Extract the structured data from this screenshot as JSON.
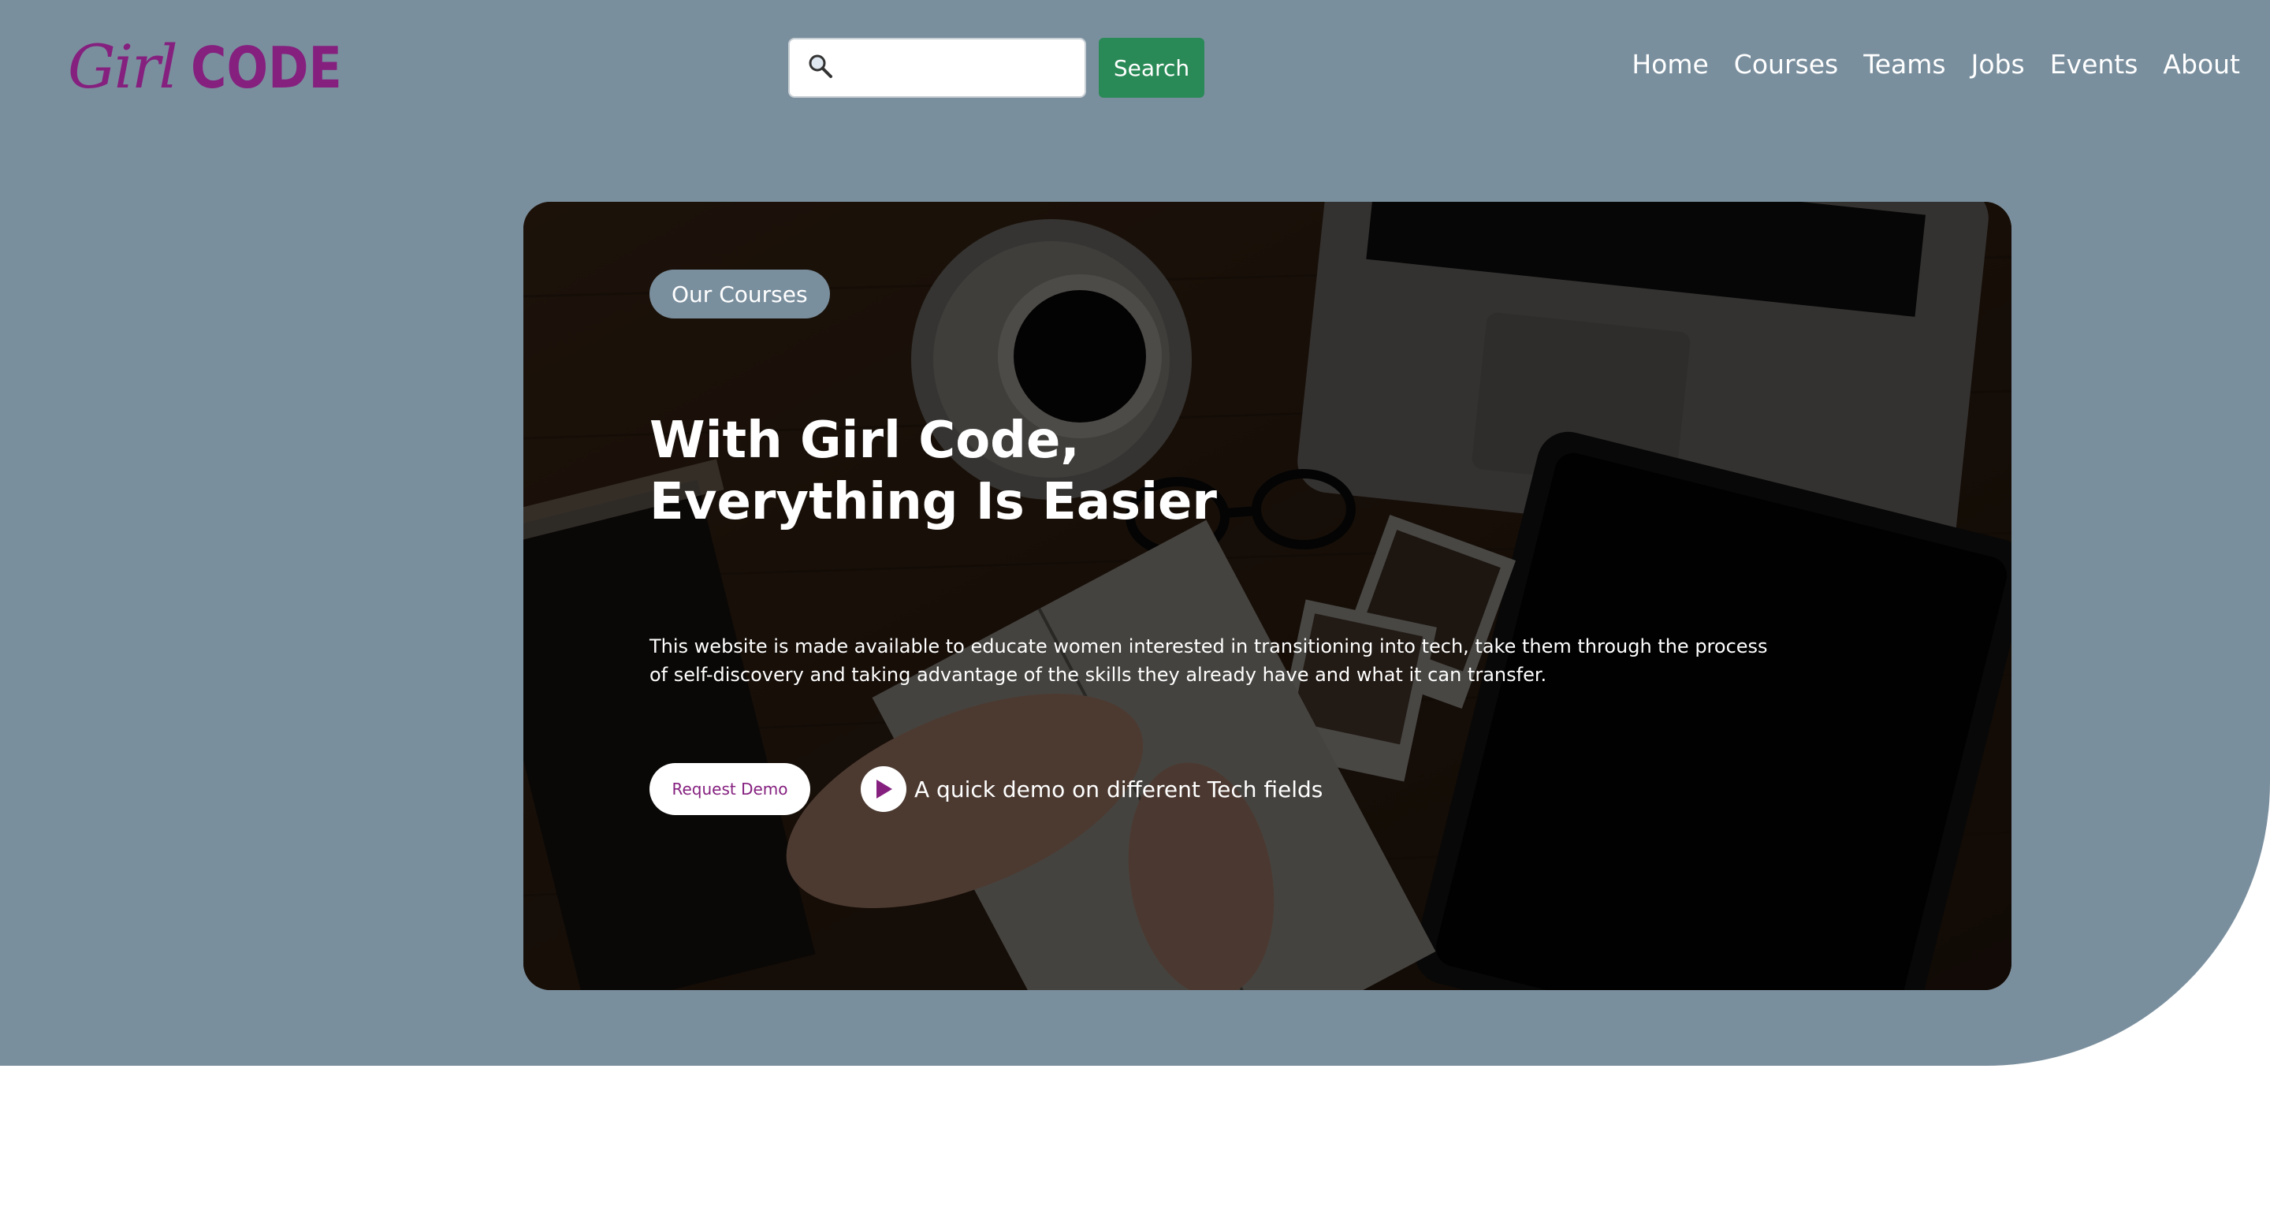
{
  "brand": {
    "logo_script": "Girl",
    "logo_bold": "CODE",
    "color": "#85207f"
  },
  "search": {
    "placeholder": "",
    "value": "",
    "button_label": "Search",
    "icon": "magnifier-icon"
  },
  "nav": {
    "items": [
      "Home",
      "Courses",
      "Teams",
      "Jobs",
      "Events",
      "About"
    ]
  },
  "hero": {
    "badge": "Our Courses",
    "headline_line1": "With Girl Code,",
    "headline_line2": "Everything Is Easier",
    "description": "This website is made available to educate women interested in transitioning into tech, take them through the process of self-discovery and taking advantage of the skills they already have and what it can transfer.",
    "request_demo_label": "Request Demo",
    "demo_link_label": "A quick demo on different Tech fields",
    "demo_icon": "play-icon"
  },
  "colors": {
    "page_background": "#7a8f9e",
    "search_button": "#2a8a57",
    "badge_background": "#7a8f9e",
    "accent": "#85207f"
  }
}
